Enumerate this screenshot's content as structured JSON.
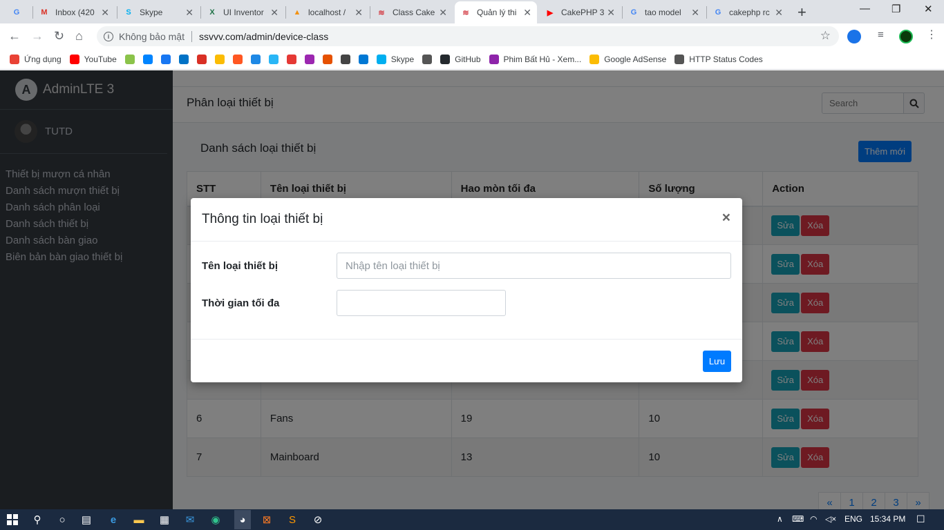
{
  "browser": {
    "tabs": [
      {
        "title": "",
        "fav_color": "#4285f4",
        "fav_glyph": "G",
        "active": false
      },
      {
        "title": "Inbox (420",
        "fav_color": "#d93025",
        "fav_glyph": "M",
        "active": false
      },
      {
        "title": "Skype",
        "fav_color": "#00aff0",
        "fav_glyph": "S",
        "active": false
      },
      {
        "title": "UI Inventor",
        "fav_color": "#1e7145",
        "fav_glyph": "X",
        "active": false
      },
      {
        "title": "localhost /",
        "fav_color": "#f29111",
        "fav_glyph": "▲",
        "active": false
      },
      {
        "title": "Class Cake",
        "fav_color": "#d33c44",
        "fav_glyph": "≋",
        "active": false
      },
      {
        "title": "Quản lý thi",
        "fav_color": "#d33c44",
        "fav_glyph": "≋",
        "active": true
      },
      {
        "title": "CakePHP 3",
        "fav_color": "#ff0000",
        "fav_glyph": "▶",
        "active": false
      },
      {
        "title": "tao model",
        "fav_color": "#4285f4",
        "fav_glyph": "G",
        "active": false
      },
      {
        "title": "cakephp rc",
        "fav_color": "#4285f4",
        "fav_glyph": "G",
        "active": false
      }
    ],
    "security_label": "Không bảo mật",
    "url": "ssvvv.com/admin/device-class",
    "bookmarks": [
      {
        "label": "Ứng dụng",
        "color": "#e94235"
      },
      {
        "label": "YouTube",
        "color": "#ff0000"
      },
      {
        "label": "",
        "color": "#8bc34a"
      },
      {
        "label": "",
        "color": "#0084ff"
      },
      {
        "label": "",
        "color": "#1877f2"
      },
      {
        "label": "",
        "color": "#0072c6"
      },
      {
        "label": "",
        "color": "#d93025"
      },
      {
        "label": "",
        "color": "#fbbc04"
      },
      {
        "label": "",
        "color": "#ff5722"
      },
      {
        "label": "",
        "color": "#1e88e5"
      },
      {
        "label": "",
        "color": "#29b6f6"
      },
      {
        "label": "",
        "color": "#e53935"
      },
      {
        "label": "",
        "color": "#9c27b0"
      },
      {
        "label": "",
        "color": "#e65100"
      },
      {
        "label": "",
        "color": "#444444"
      },
      {
        "label": "",
        "color": "#0078d4"
      },
      {
        "label": "Skype",
        "color": "#00aff0"
      },
      {
        "label": "",
        "color": "#555555"
      },
      {
        "label": "GitHub",
        "color": "#24292e"
      },
      {
        "label": "Phim Bất Hủ - Xem...",
        "color": "#8e24aa"
      },
      {
        "label": "Google AdSense",
        "color": "#fbbc04"
      },
      {
        "label": "HTTP Status Codes",
        "color": "#555555"
      }
    ]
  },
  "sidebar": {
    "brand": "AdminLTE 3",
    "user": "TUTD",
    "menu": [
      "Thiết bị mượn cá nhân",
      "Danh sách mượn thiết bị",
      "Danh sách phân loại",
      "Danh sách thiết bị",
      "Danh sách bàn giao",
      "Biên bản bàn giao thiết bị"
    ]
  },
  "header": {
    "title": "Phân loại thiết bị",
    "search_placeholder": "Search"
  },
  "card": {
    "title": "Danh sách loại thiết bị",
    "new_button": "Thêm mới"
  },
  "table": {
    "columns": [
      "STT",
      "Tên loại thiết bị",
      "Hao mòn tối đa",
      "Số lượng",
      "Action"
    ],
    "rows": [
      [
        "",
        "",
        "",
        ""
      ],
      [
        "",
        "",
        "",
        ""
      ],
      [
        "",
        "",
        "",
        ""
      ],
      [
        "",
        "",
        "",
        ""
      ],
      [
        "",
        "",
        "",
        ""
      ],
      [
        "6",
        "Fans",
        "19",
        "10"
      ],
      [
        "7",
        "Mainboard",
        "13",
        "10"
      ]
    ],
    "edit_label": "Sửa",
    "delete_label": "Xóa"
  },
  "pagination": [
    "«",
    "1",
    "2",
    "3",
    "»"
  ],
  "modal": {
    "title": "Thông tin loại thiết bị",
    "close": "×",
    "field1_label": "Tên loại thiết bị",
    "field1_placeholder": "Nhập tên loại thiết bị",
    "field1_value": "",
    "field2_label": "Thời gian tối đa",
    "field2_value": "",
    "save_label": "Lưu"
  },
  "taskbar": {
    "lang": "ENG",
    "time": "15:34 PM"
  }
}
